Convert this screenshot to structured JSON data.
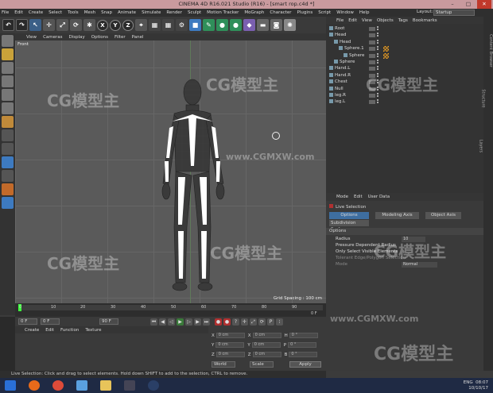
{
  "app": {
    "title": "CINEMA 4D R16.021 Studio (R16) - [smart rop.c4d *]"
  },
  "menubar": [
    "File",
    "Edit",
    "Create",
    "Select",
    "Tools",
    "Mesh",
    "Snap",
    "Animate",
    "Simulate",
    "Render",
    "Sculpt",
    "Motion Tracker",
    "MoGraph",
    "Character",
    "Plugins",
    "Script",
    "Window",
    "Help"
  ],
  "layout": {
    "label": "Layout:",
    "value": "Startup"
  },
  "toolbar": {
    "axes": [
      "X",
      "Y",
      "Z"
    ]
  },
  "viewport": {
    "menu": [
      "View",
      "Cameras",
      "Display",
      "Options",
      "Filter",
      "Panel"
    ],
    "label": "Front",
    "grid_spacing": "Grid Spacing : 100 cm"
  },
  "watermarks": {
    "logo_text": "CG模型主",
    "url": "www.CGMXW.com"
  },
  "timeline": {
    "ticks": [
      "0",
      "10",
      "20",
      "30",
      "40",
      "50",
      "60",
      "70",
      "80",
      "90"
    ],
    "end_label": "0 F"
  },
  "playbar": {
    "start": "0 F",
    "current": "0 F",
    "end": "90 F"
  },
  "material": {
    "menu": [
      "Create",
      "Edit",
      "Function",
      "Texture"
    ]
  },
  "coords": {
    "labels": [
      "X",
      "Y",
      "Z"
    ],
    "pos": [
      "0 cm",
      "0 cm",
      "0 cm"
    ],
    "size": [
      "0 cm",
      "0 cm",
      "0 cm"
    ],
    "rot": [
      "H",
      "P",
      "B"
    ],
    "rot_vals": [
      "0 °",
      "0 °",
      "0 °"
    ],
    "world": "World",
    "scale": "Scale",
    "apply": "Apply"
  },
  "status": "Live Selection: Click and drag to select elements. Hold down SHIFT to add to the selection, CTRL to remove.",
  "objects": {
    "menu": [
      "File",
      "Edit",
      "View",
      "Objects",
      "Tags",
      "Bookmarks"
    ],
    "rows": [
      "Root",
      "Head",
      "Head",
      "Sphere.1",
      "Sphere",
      "Sphere",
      "Hand.L",
      "Hand.R",
      "Chest",
      "Null",
      "leg.R",
      "leg.L"
    ]
  },
  "attributes": {
    "menu": [
      "Mode",
      "Edit",
      "User Data"
    ],
    "title": "Live Selection",
    "tabs": [
      "Options",
      "Modeling Axis",
      "Object Axis"
    ],
    "subtab": "Subdivision Surface",
    "section": "Options",
    "fields": [
      {
        "label": "Radius",
        "value": "10"
      },
      {
        "label": "Pressure Dependent Radius",
        "value": ""
      },
      {
        "label": "Only Select Visible Elements",
        "value": ""
      },
      {
        "label": "Tolerant Edge/Polygon Selection",
        "value": ""
      },
      {
        "label": "Mode",
        "value": "Normal"
      }
    ]
  },
  "sidetabs": [
    "Content Browser",
    "Structure",
    "Layers"
  ],
  "clock": {
    "lang": "ENG",
    "time": "08:07",
    "date": "10/10/17"
  },
  "colors": {
    "titlebar": "#c99a9e",
    "timeline_marker": "#3cff3c",
    "tag_orange": "#f0a020"
  }
}
